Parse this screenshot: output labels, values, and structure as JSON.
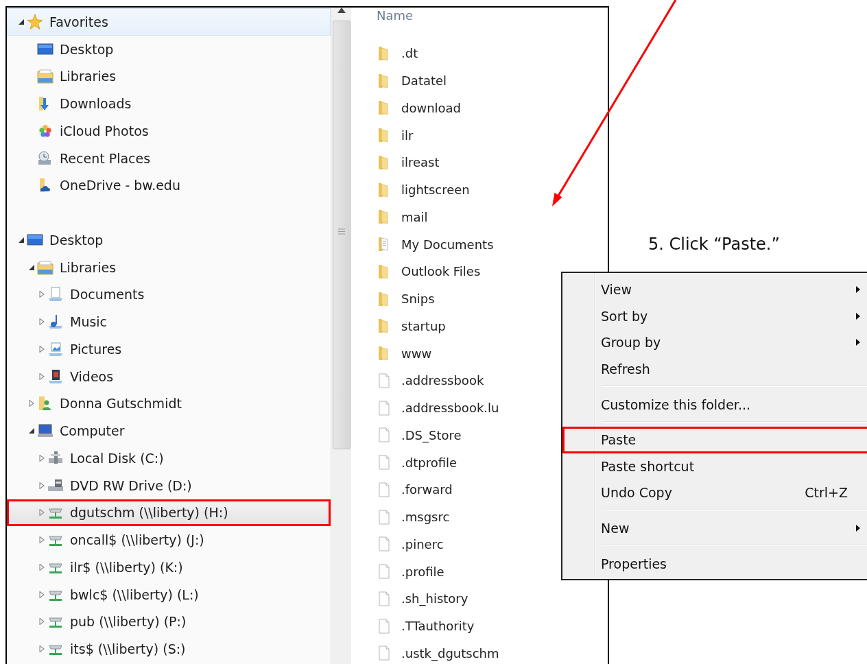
{
  "nav": {
    "trees": [
      {
        "label": "Favorites",
        "kind": "star",
        "expanded": true,
        "selected": false,
        "hovered": true,
        "highlighted": false,
        "children": [
          {
            "label": "Desktop",
            "kind": "desktop",
            "selected": false,
            "hovered": false,
            "highlighted": false
          },
          {
            "label": "Libraries",
            "kind": "library",
            "selected": false,
            "hovered": false,
            "highlighted": false
          },
          {
            "label": "Downloads",
            "kind": "downloads",
            "selected": false,
            "hovered": false,
            "highlighted": false
          },
          {
            "label": "iCloud Photos",
            "kind": "photos",
            "selected": false,
            "hovered": false,
            "highlighted": false
          },
          {
            "label": "Recent Places",
            "kind": "recent",
            "selected": false,
            "hovered": false,
            "highlighted": false
          },
          {
            "label": "OneDrive - bw.edu",
            "kind": "onedrive",
            "selected": false,
            "hovered": false,
            "highlighted": false
          }
        ]
      },
      {
        "label": "Desktop",
        "kind": "desktop",
        "expanded": true,
        "selected": false,
        "hovered": false,
        "highlighted": false,
        "children": [
          {
            "label": "Libraries",
            "kind": "library",
            "expanded": true,
            "selected": false,
            "hovered": false,
            "highlighted": false,
            "children": [
              {
                "label": "Documents",
                "kind": "documents",
                "expanded": false,
                "selected": false,
                "hovered": false,
                "highlighted": false
              },
              {
                "label": "Music",
                "kind": "music",
                "expanded": false,
                "selected": false,
                "hovered": false,
                "highlighted": false
              },
              {
                "label": "Pictures",
                "kind": "pictures",
                "expanded": false,
                "selected": false,
                "hovered": false,
                "highlighted": false
              },
              {
                "label": "Videos",
                "kind": "videos",
                "expanded": false,
                "selected": false,
                "hovered": false,
                "highlighted": false
              }
            ]
          },
          {
            "label": "Donna Gutschmidt",
            "kind": "user-folder",
            "expanded": false,
            "selected": false,
            "hovered": false,
            "highlighted": false
          },
          {
            "label": "Computer",
            "kind": "computer",
            "expanded": true,
            "selected": false,
            "hovered": false,
            "highlighted": false,
            "children": [
              {
                "label": "Local Disk (C:)",
                "kind": "disk",
                "expanded": false,
                "selected": false,
                "hovered": false,
                "highlighted": false
              },
              {
                "label": "DVD RW Drive (D:)",
                "kind": "dvd",
                "expanded": false,
                "selected": false,
                "hovered": false,
                "highlighted": false
              },
              {
                "label": "dgutschm (\\\\liberty) (H:)",
                "kind": "network-drive",
                "expanded": false,
                "selected": true,
                "hovered": false,
                "highlighted": true
              },
              {
                "label": "oncall$ (\\\\liberty) (J:)",
                "kind": "network-drive",
                "expanded": false,
                "selected": false,
                "hovered": false,
                "highlighted": false
              },
              {
                "label": "ilr$ (\\\\liberty) (K:)",
                "kind": "network-drive",
                "expanded": false,
                "selected": false,
                "hovered": false,
                "highlighted": false
              },
              {
                "label": "bwlc$ (\\\\liberty) (L:)",
                "kind": "network-drive",
                "expanded": false,
                "selected": false,
                "hovered": false,
                "highlighted": false
              },
              {
                "label": "pub (\\\\liberty) (P:)",
                "kind": "network-drive",
                "expanded": false,
                "selected": false,
                "hovered": false,
                "highlighted": false
              },
              {
                "label": "its$ (\\\\liberty) (S:)",
                "kind": "network-drive",
                "expanded": false,
                "selected": false,
                "hovered": false,
                "highlighted": false
              }
            ]
          }
        ]
      }
    ]
  },
  "files": {
    "column_header": "Name",
    "items": [
      {
        "name": ".dt",
        "kind": "folder"
      },
      {
        "name": "Datatel",
        "kind": "folder"
      },
      {
        "name": "download",
        "kind": "folder"
      },
      {
        "name": "ilr",
        "kind": "folder"
      },
      {
        "name": "ilreast",
        "kind": "folder"
      },
      {
        "name": "lightscreen",
        "kind": "folder"
      },
      {
        "name": "mail",
        "kind": "folder"
      },
      {
        "name": "My Documents",
        "kind": "documents-folder"
      },
      {
        "name": "Outlook Files",
        "kind": "folder"
      },
      {
        "name": "Snips",
        "kind": "folder"
      },
      {
        "name": "startup",
        "kind": "folder"
      },
      {
        "name": "www",
        "kind": "folder"
      },
      {
        "name": ".addressbook",
        "kind": "file"
      },
      {
        "name": ".addressbook.lu",
        "kind": "file"
      },
      {
        "name": ".DS_Store",
        "kind": "file"
      },
      {
        "name": ".dtprofile",
        "kind": "file"
      },
      {
        "name": ".forward",
        "kind": "file"
      },
      {
        "name": ".msgsrc",
        "kind": "file"
      },
      {
        "name": ".pinerc",
        "kind": "file"
      },
      {
        "name": ".profile",
        "kind": "file"
      },
      {
        "name": ".sh_history",
        "kind": "file"
      },
      {
        "name": ".TTauthority",
        "kind": "file"
      },
      {
        "name": ".ustk_dgutschm",
        "kind": "file"
      }
    ]
  },
  "instruction": "5.  Click “Paste.”",
  "context_menu": {
    "groups": [
      [
        {
          "label": "View",
          "submenu": true,
          "highlighted": false
        },
        {
          "label": "Sort by",
          "submenu": true,
          "highlighted": false
        },
        {
          "label": "Group by",
          "submenu": true,
          "highlighted": false
        },
        {
          "label": "Refresh",
          "submenu": false,
          "highlighted": false
        }
      ],
      [
        {
          "label": "Customize this folder...",
          "submenu": false,
          "highlighted": false
        }
      ],
      [
        {
          "label": "Paste",
          "submenu": false,
          "highlighted": true
        },
        {
          "label": "Paste shortcut",
          "submenu": false,
          "highlighted": false
        },
        {
          "label": "Undo Copy",
          "shortcut": "Ctrl+Z",
          "submenu": false,
          "highlighted": false
        }
      ],
      [
        {
          "label": "New",
          "submenu": true,
          "highlighted": false
        }
      ],
      [
        {
          "label": "Properties",
          "submenu": false,
          "highlighted": false
        }
      ]
    ]
  }
}
